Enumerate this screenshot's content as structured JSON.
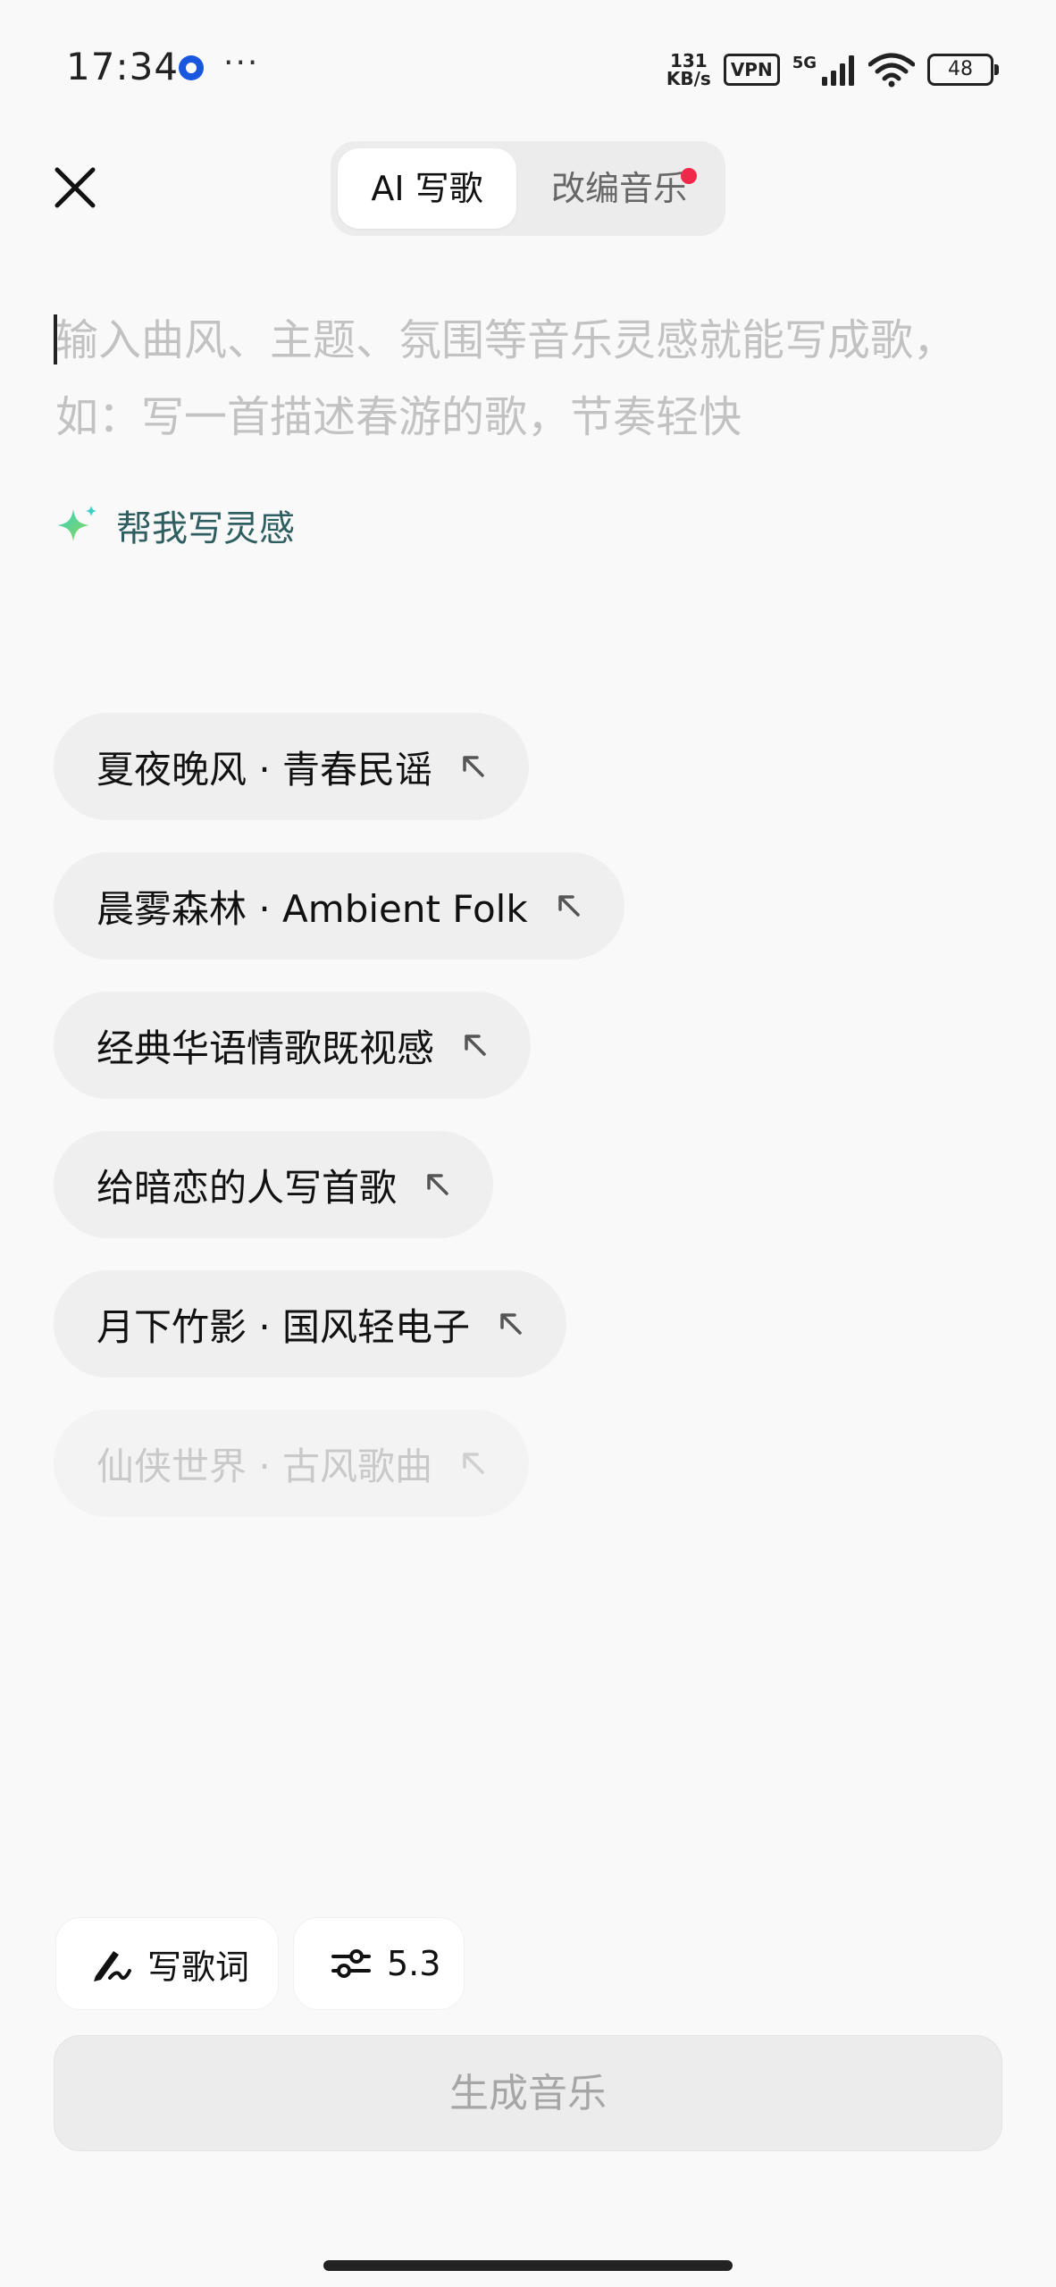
{
  "status_bar": {
    "time": "17:34",
    "more": "···",
    "net_speed_value": "131",
    "net_speed_unit": "KB/s",
    "vpn": "VPN",
    "network": "5G",
    "battery": "48"
  },
  "header": {
    "tabs": [
      {
        "label": "AI 写歌",
        "active": true
      },
      {
        "label": "改编音乐",
        "active": false,
        "badge": "red-dot"
      }
    ],
    "close_icon": "close-icon"
  },
  "prompt": {
    "placeholder": "输入曲风、主题、氛围等音乐灵感就能写成歌，如：写一首描述春游的歌，节奏轻快",
    "value": ""
  },
  "inspire": {
    "label": "帮我写灵感",
    "icon": "sparkle-icon"
  },
  "suggestions": [
    {
      "label": "夏夜晚风 · 青春民谣"
    },
    {
      "label": "晨雾森林 · Ambient Folk"
    },
    {
      "label": "经典华语情歌既视感"
    },
    {
      "label": "给暗恋的人写首歌"
    },
    {
      "label": "月下竹影 · 国风轻电子"
    },
    {
      "label": "仙侠世界 · 古风歌曲"
    }
  ],
  "controls": {
    "lyrics_label": "写歌词",
    "version_label": "5.3",
    "generate_label": "生成音乐"
  },
  "colors": {
    "accent_teal": "#2f5e61",
    "badge_red": "#f0294b",
    "placeholder": "#c2c2c2"
  }
}
